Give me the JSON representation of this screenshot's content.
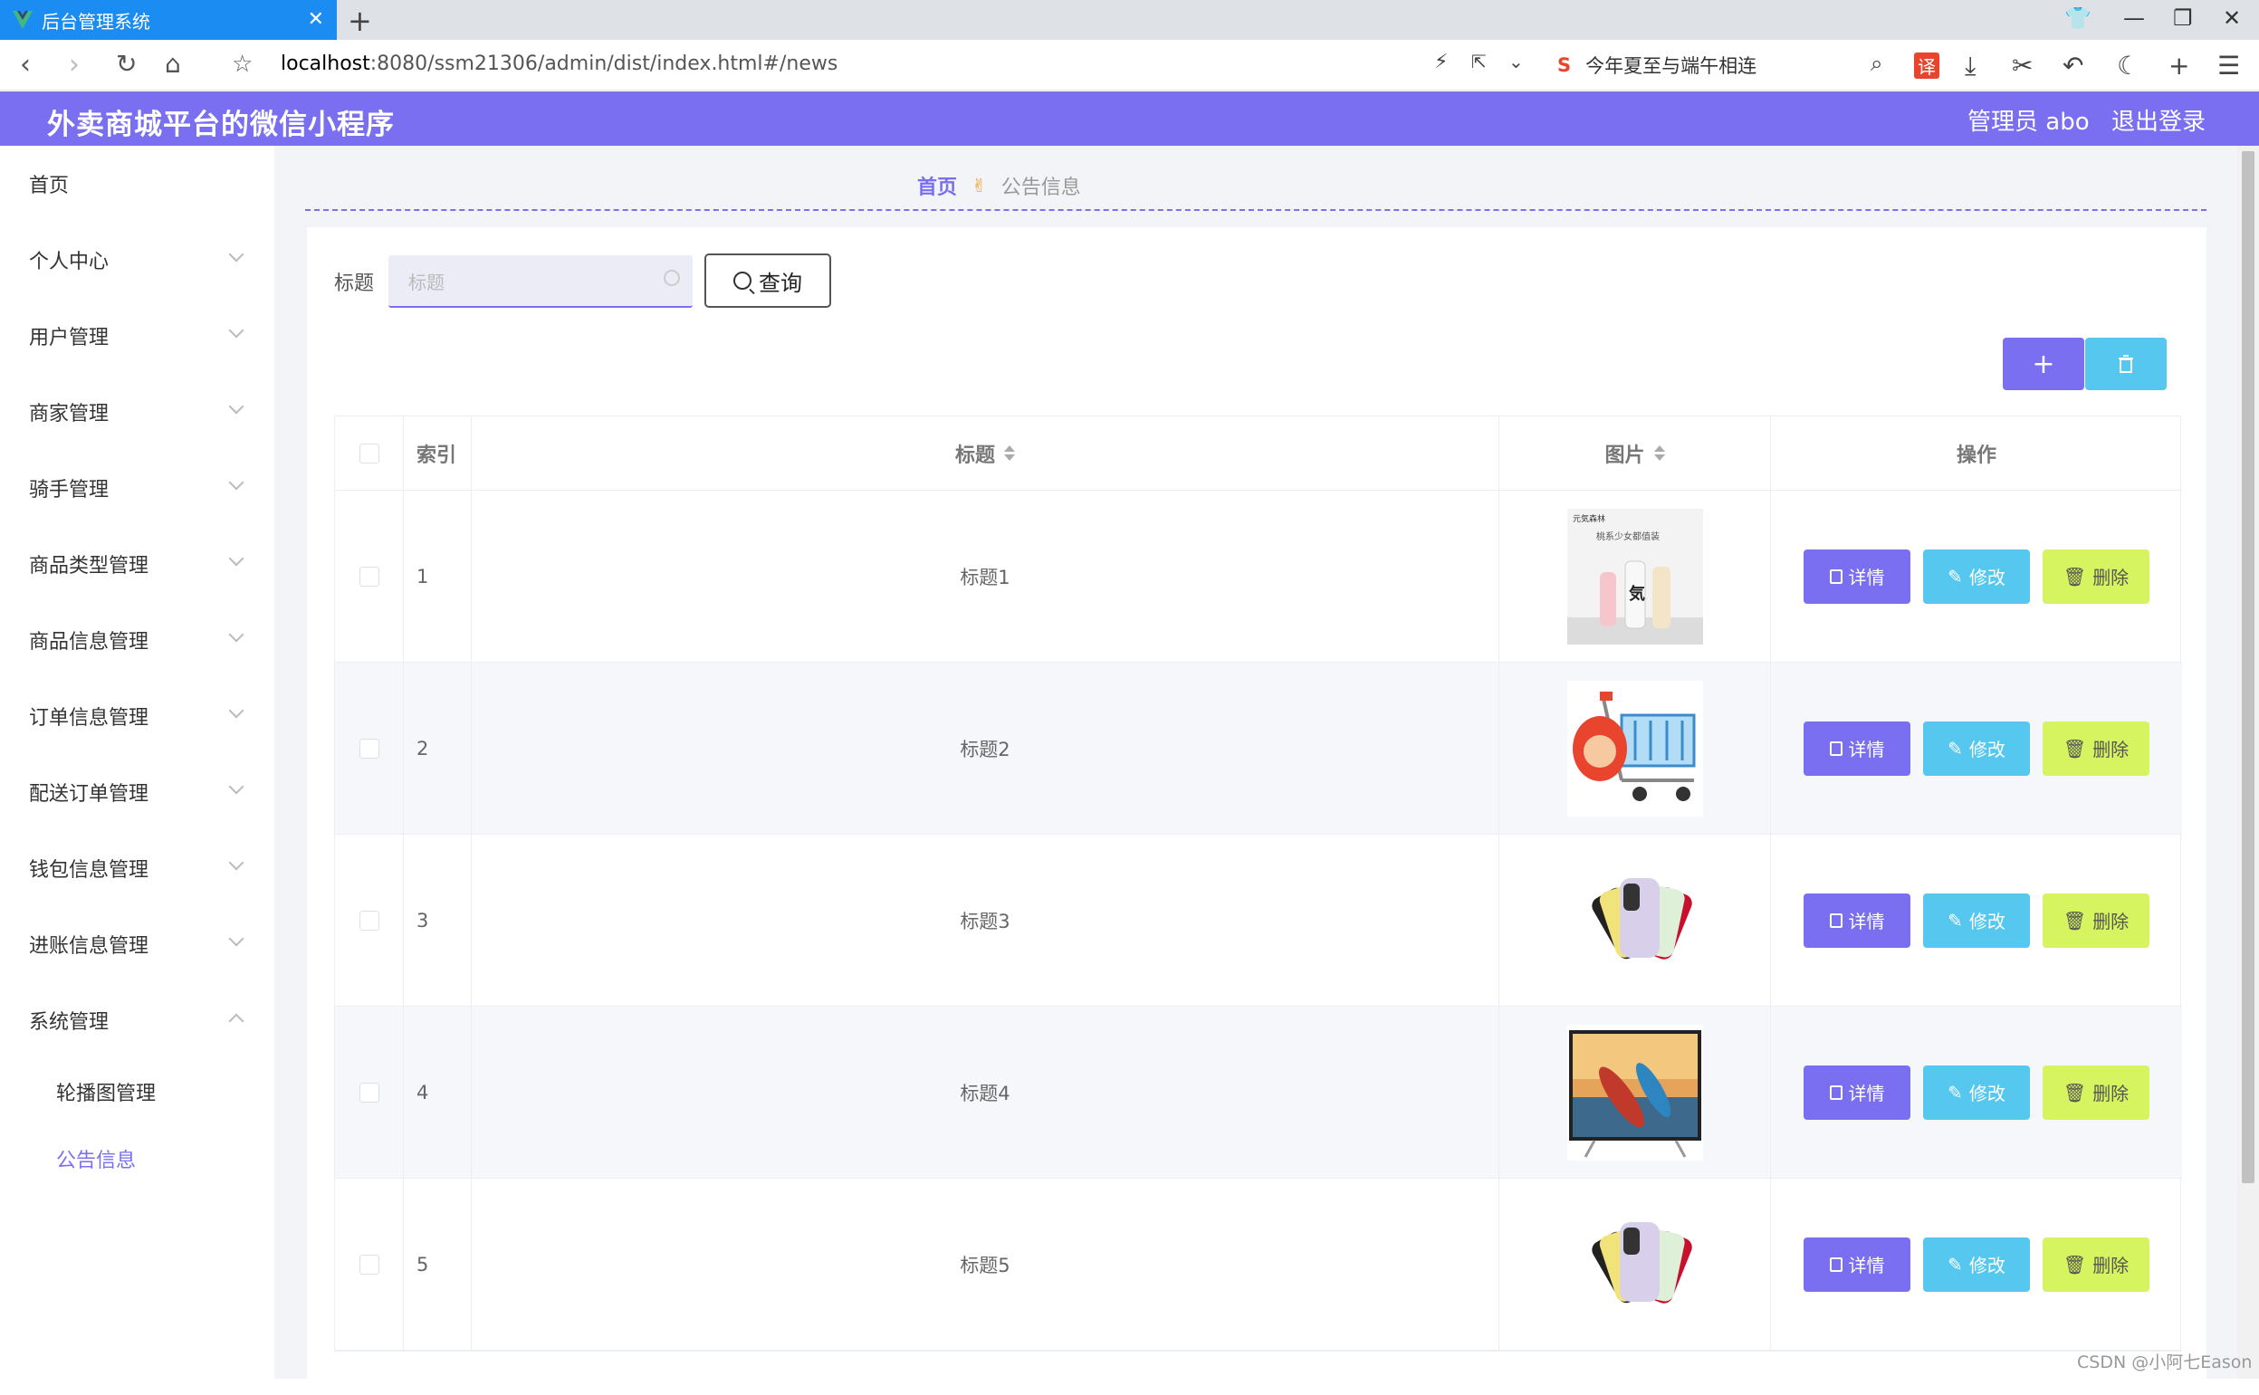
{
  "browser": {
    "tab_title": "后台管理系统",
    "url_host": "localhost",
    "url_path": ":8080/ssm21306/admin/dist/index.html#/news",
    "search_text": "今年夏至与端午相连"
  },
  "header": {
    "title": "外卖商城平台的微信小程序",
    "admin_label": "管理员 abo",
    "logout_label": "退出登录"
  },
  "sidebar": {
    "items": [
      {
        "label": "首页"
      },
      {
        "label": "个人中心"
      },
      {
        "label": "用户管理"
      },
      {
        "label": "商家管理"
      },
      {
        "label": "骑手管理"
      },
      {
        "label": "商品类型管理"
      },
      {
        "label": "商品信息管理"
      },
      {
        "label": "订单信息管理"
      },
      {
        "label": "配送订单管理"
      },
      {
        "label": "钱包信息管理"
      },
      {
        "label": "进账信息管理"
      },
      {
        "label": "系统管理"
      }
    ],
    "subitems": [
      {
        "label": "轮播图管理"
      },
      {
        "label": "公告信息"
      }
    ]
  },
  "breadcrumb": {
    "home": "首页",
    "current": "公告信息"
  },
  "search": {
    "label": "标题",
    "placeholder": "标题",
    "button_label": "查询"
  },
  "table": {
    "headers": {
      "index": "索引",
      "title": "标题",
      "image": "图片",
      "ops": "操作"
    },
    "rows": [
      {
        "index": "1",
        "title": "标题1",
        "image_icon": "drink-bottles-image"
      },
      {
        "index": "2",
        "title": "标题2",
        "image_icon": "shopping-cart-mascot-image"
      },
      {
        "index": "3",
        "title": "标题3",
        "image_icon": "phone-colors-image"
      },
      {
        "index": "4",
        "title": "标题4",
        "image_icon": "kayak-tv-image"
      },
      {
        "index": "5",
        "title": "标题5",
        "image_icon": "phone-colors-image"
      }
    ],
    "op_labels": {
      "detail": "详情",
      "edit": "修改",
      "delete": "删除"
    }
  },
  "thumb_texts": {
    "brand": "元気森林",
    "caption": "桃系少女都值装",
    "char": "気"
  },
  "watermark": "CSDN @小阿七Eason",
  "colors": {
    "accent": "#7a6ff0",
    "info": "#56c8f0",
    "warn": "#d6f45f",
    "tab": "#1a8cf2"
  }
}
